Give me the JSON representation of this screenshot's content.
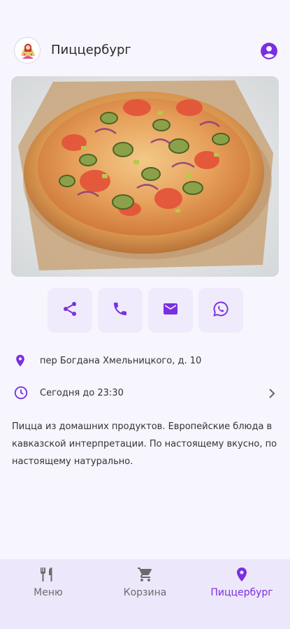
{
  "header": {
    "title": "Пиццербург",
    "logo_icon": "restaurant-logo",
    "profile_icon": "account-circle-icon"
  },
  "hero": {
    "image_icon": "pizza-photo"
  },
  "actions": [
    {
      "name": "share",
      "icon": "share-icon"
    },
    {
      "name": "call",
      "icon": "phone-icon"
    },
    {
      "name": "email",
      "icon": "mail-icon"
    },
    {
      "name": "whatsapp",
      "icon": "whatsapp-icon"
    }
  ],
  "info": {
    "address": "пер Богдана Хмельницкого, д. 10",
    "hours": "Сегодня до 23:30"
  },
  "description": "Пицца из домашних продуктов. Европейские блюда в кавказской интерпретации. По настоящему вкусно, по настоящему натурально.",
  "nav": {
    "items": [
      {
        "label": "Меню",
        "icon": "cutlery-icon",
        "active": false
      },
      {
        "label": "Корзина",
        "icon": "cart-icon",
        "active": false
      },
      {
        "label": "Пиццербург",
        "icon": "location-pin-icon",
        "active": true
      }
    ]
  },
  "colors": {
    "accent": "#7a2fe0",
    "background": "#f7f5fd",
    "action_tile": "#efebfc",
    "nav_bg": "#ede7fc",
    "nav_inactive": "#6b6b6b"
  }
}
